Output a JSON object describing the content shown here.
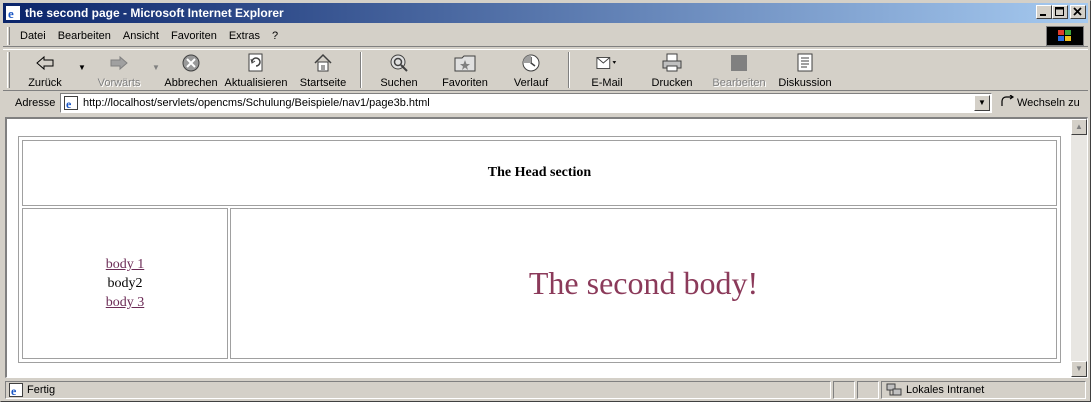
{
  "window": {
    "title": "the second page - Microsoft Internet Explorer",
    "buttons": [
      "minimize",
      "maximize",
      "close"
    ]
  },
  "menu": [
    {
      "label": "Datei"
    },
    {
      "label": "Bearbeiten"
    },
    {
      "label": "Ansicht"
    },
    {
      "label": "Favoriten"
    },
    {
      "label": "Extras"
    },
    {
      "label": "?"
    }
  ],
  "toolbar": {
    "back": {
      "label": "Zurück",
      "icon": "back-arrow-icon"
    },
    "forward": {
      "label": "Vorwärts",
      "icon": "forward-arrow-icon",
      "disabled": true
    },
    "stop": {
      "label": "Abbrechen",
      "icon": "stop-icon"
    },
    "refresh": {
      "label": "Aktualisieren",
      "icon": "refresh-icon"
    },
    "home": {
      "label": "Startseite",
      "icon": "home-icon"
    },
    "search": {
      "label": "Suchen",
      "icon": "search-icon"
    },
    "favorites": {
      "label": "Favoriten",
      "icon": "favorites-icon"
    },
    "history": {
      "label": "Verlauf",
      "icon": "history-icon"
    },
    "mail": {
      "label": "E-Mail",
      "icon": "mail-icon"
    },
    "print": {
      "label": "Drucken",
      "icon": "print-icon"
    },
    "edit": {
      "label": "Bearbeiten",
      "icon": "edit-icon",
      "disabled": true
    },
    "discuss": {
      "label": "Diskussion",
      "icon": "discuss-icon"
    }
  },
  "address": {
    "label": "Adresse",
    "url": "http://localhost/servlets/opencms/Schulung/Beispiele/nav1/page3b.html",
    "go_label": "Wechseln zu"
  },
  "page": {
    "head": "The Head section",
    "nav": {
      "link1": "body 1",
      "current": "body2",
      "link3": "body 3"
    },
    "body_text": "The second body!"
  },
  "status": {
    "text": "Fertig",
    "zone": "Lokales Intranet"
  },
  "colors": {
    "titlebar_start": "#0a246a",
    "titlebar_end": "#a6caf0",
    "chrome": "#d4d0c8",
    "visited_link": "#6b2a55",
    "body_text": "#8b3a5a"
  }
}
